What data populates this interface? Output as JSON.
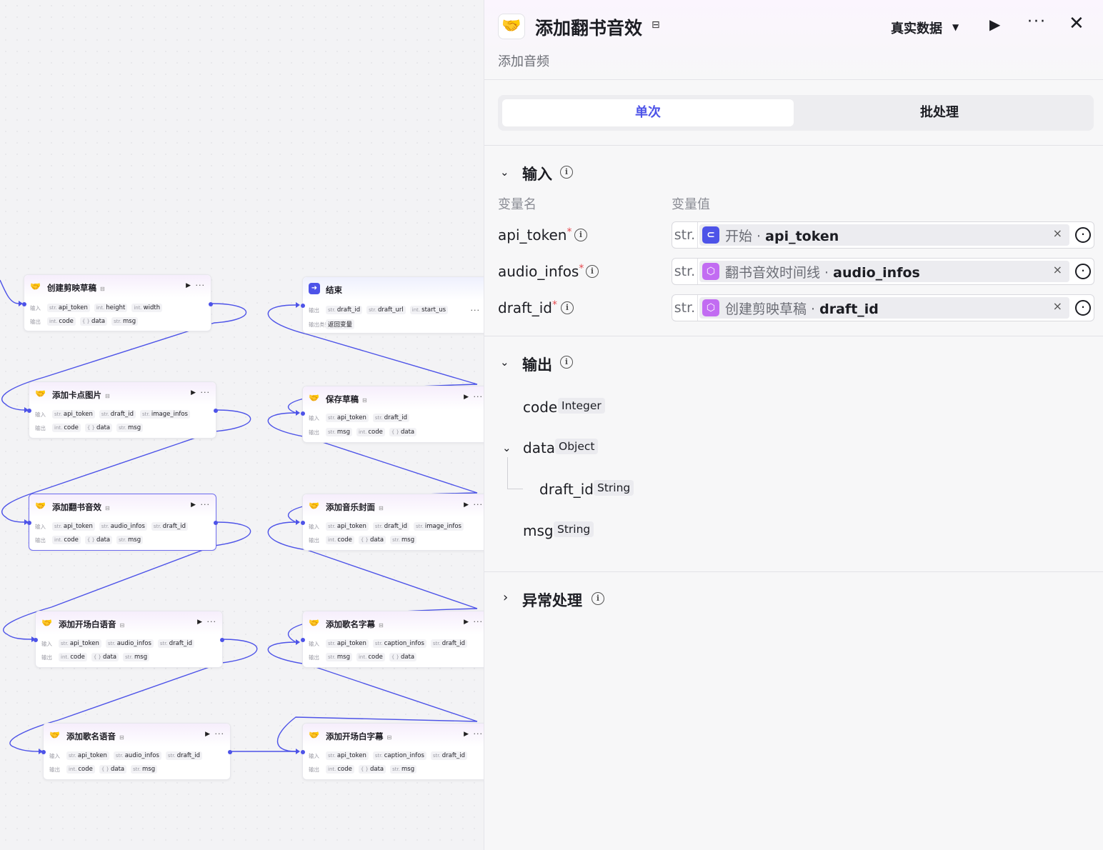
{
  "canvas": {
    "nodes": [
      {
        "id": "create",
        "icon": "handshake-icon",
        "title": "创建剪映草稿",
        "in_label": "输入",
        "out_label": "输出",
        "inputs": [
          {
            "t": "str.",
            "n": "api_token"
          },
          {
            "t": "int.",
            "n": "height"
          },
          {
            "t": "int.",
            "n": "width"
          }
        ],
        "outputs": [
          {
            "t": "int.",
            "n": "code"
          },
          {
            "t": "{ }",
            "n": "data"
          },
          {
            "t": "str.",
            "n": "msg"
          }
        ]
      },
      {
        "id": "end",
        "icon": "end-icon",
        "title": "结束",
        "in_label": "输出",
        "out_label": "输出类型",
        "inputs": [
          {
            "t": "str.",
            "n": "draft_id"
          },
          {
            "t": "str.",
            "n": "draft_url"
          },
          {
            "t": "int.",
            "n": "start_us"
          }
        ],
        "outputs": [
          {
            "t": "",
            "n": "返回变量"
          }
        ]
      },
      {
        "id": "kadian",
        "icon": "handshake-icon",
        "title": "添加卡点图片",
        "in_label": "输入",
        "out_label": "输出",
        "inputs": [
          {
            "t": "str.",
            "n": "api_token"
          },
          {
            "t": "str.",
            "n": "draft_id"
          },
          {
            "t": "str.",
            "n": "image_infos"
          }
        ],
        "outputs": [
          {
            "t": "int.",
            "n": "code"
          },
          {
            "t": "{ }",
            "n": "data"
          },
          {
            "t": "str.",
            "n": "msg"
          }
        ]
      },
      {
        "id": "save",
        "icon": "handshake-icon",
        "title": "保存草稿",
        "in_label": "输入",
        "out_label": "输出",
        "inputs": [
          {
            "t": "str.",
            "n": "api_token"
          },
          {
            "t": "str.",
            "n": "draft_id"
          }
        ],
        "outputs": [
          {
            "t": "str.",
            "n": "msg"
          },
          {
            "t": "int.",
            "n": "code"
          },
          {
            "t": "{ }",
            "n": "data"
          }
        ]
      },
      {
        "id": "fanshu",
        "icon": "handshake-icon",
        "title": "添加翻书音效",
        "in_label": "输入",
        "out_label": "输出",
        "inputs": [
          {
            "t": "str.",
            "n": "api_token"
          },
          {
            "t": "str.",
            "n": "audio_infos"
          },
          {
            "t": "str.",
            "n": "draft_id"
          }
        ],
        "outputs": [
          {
            "t": "int.",
            "n": "code"
          },
          {
            "t": "{ }",
            "n": "data"
          },
          {
            "t": "str.",
            "n": "msg"
          }
        ]
      },
      {
        "id": "music_cover",
        "icon": "handshake-icon",
        "title": "添加音乐封面",
        "in_label": "输入",
        "out_label": "输出",
        "inputs": [
          {
            "t": "str.",
            "n": "api_token"
          },
          {
            "t": "str.",
            "n": "draft_id"
          },
          {
            "t": "str.",
            "n": "image_infos"
          }
        ],
        "outputs": [
          {
            "t": "int.",
            "n": "code"
          },
          {
            "t": "{ }",
            "n": "data"
          },
          {
            "t": "str.",
            "n": "msg"
          }
        ]
      },
      {
        "id": "opening_voice",
        "icon": "handshake-icon",
        "title": "添加开场白语音",
        "in_label": "输入",
        "out_label": "输出",
        "inputs": [
          {
            "t": "str.",
            "n": "api_token"
          },
          {
            "t": "str.",
            "n": "audio_infos"
          },
          {
            "t": "str.",
            "n": "draft_id"
          }
        ],
        "outputs": [
          {
            "t": "int.",
            "n": "code"
          },
          {
            "t": "{ }",
            "n": "data"
          },
          {
            "t": "str.",
            "n": "msg"
          }
        ]
      },
      {
        "id": "song_caption",
        "icon": "handshake-icon",
        "title": "添加歌名字幕",
        "in_label": "输入",
        "out_label": "输出",
        "inputs": [
          {
            "t": "str.",
            "n": "api_token"
          },
          {
            "t": "str.",
            "n": "caption_infos"
          },
          {
            "t": "str.",
            "n": "draft_id"
          }
        ],
        "outputs": [
          {
            "t": "str.",
            "n": "msg"
          },
          {
            "t": "int.",
            "n": "code"
          },
          {
            "t": "{ }",
            "n": "data"
          }
        ]
      },
      {
        "id": "song_voice",
        "icon": "handshake-icon",
        "title": "添加歌名语音",
        "in_label": "输入",
        "out_label": "输出",
        "inputs": [
          {
            "t": "str.",
            "n": "api_token"
          },
          {
            "t": "str.",
            "n": "audio_infos"
          },
          {
            "t": "str.",
            "n": "draft_id"
          }
        ],
        "outputs": [
          {
            "t": "int.",
            "n": "code"
          },
          {
            "t": "{ }",
            "n": "data"
          },
          {
            "t": "str.",
            "n": "msg"
          }
        ]
      },
      {
        "id": "opening_caption",
        "icon": "handshake-icon",
        "title": "添加开场白字幕",
        "in_label": "输入",
        "out_label": "输出",
        "inputs": [
          {
            "t": "str.",
            "n": "api_token"
          },
          {
            "t": "str.",
            "n": "caption_infos"
          },
          {
            "t": "str.",
            "n": "draft_id"
          }
        ],
        "outputs": [
          {
            "t": "int.",
            "n": "code"
          },
          {
            "t": "{ }",
            "n": "data"
          },
          {
            "t": "str.",
            "n": "msg"
          }
        ]
      }
    ]
  },
  "panel": {
    "icon": "handshake-icon",
    "title": "添加翻书音效",
    "subtitle": "添加音频",
    "mode": "真实数据",
    "tabs": {
      "single": "单次",
      "batch": "批处理"
    },
    "input": {
      "title": "输入",
      "col_name": "变量名",
      "col_value": "变量值",
      "rows": [
        {
          "name": "api_token",
          "type": "str.",
          "ref_icon": "start-icon",
          "ref_node": "开始",
          "ref_var": "api_token"
        },
        {
          "name": "audio_infos",
          "type": "str.",
          "ref_icon": "plugin-cube-icon",
          "ref_node": "翻书音效时间线",
          "ref_var": "audio_infos"
        },
        {
          "name": "draft_id",
          "type": "str.",
          "ref_icon": "plugin-cube-icon",
          "ref_node": "创建剪映草稿",
          "ref_var": "draft_id"
        }
      ]
    },
    "output": {
      "title": "输出",
      "code": {
        "name": "code",
        "type": "Integer"
      },
      "data": {
        "name": "data",
        "type": "Object"
      },
      "draft_id": {
        "name": "draft_id",
        "type": "String"
      },
      "msg": {
        "name": "msg",
        "type": "String"
      }
    },
    "exception": {
      "title": "异常处理"
    }
  },
  "colors": {
    "accent": "#4d53e8",
    "edge": "#4d53e8",
    "plugin": "#c26cf2",
    "required": "#e5484d"
  }
}
